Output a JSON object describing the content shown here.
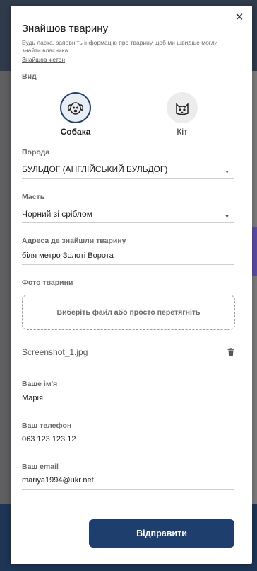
{
  "modal": {
    "title": "Знайшов тварину",
    "subtitle": "Будь ласка, заповніть інформацію про тварину щоб ми швидше могли знайти власника",
    "tag_link": "Знайшов жетон"
  },
  "species": {
    "label": "Вид",
    "options": [
      {
        "name": "Собака",
        "icon": "dog-icon",
        "selected": true
      },
      {
        "name": "Кіт",
        "icon": "cat-icon",
        "selected": false
      }
    ]
  },
  "breed": {
    "label": "Порода",
    "value": "БУЛЬДОГ (АНГЛІЙСЬКИЙ БУЛЬДОГ)"
  },
  "color": {
    "label": "Масть",
    "value": "Чорний зі сріблом"
  },
  "address": {
    "label": "Адреса де знайшли тварину",
    "value": "біля метро Золоті Ворота"
  },
  "photo": {
    "label": "Фото тварини",
    "dropzone": "Виберіть файл або просто перетягніть",
    "file_name": "Screenshot_1.jpg"
  },
  "name": {
    "label": "Ваше ім'я",
    "value": "Марія"
  },
  "phone": {
    "label": "Ваш телефон",
    "value": "063 123 123 12"
  },
  "email": {
    "label": "Ваш email",
    "value": "mariya1994@ukr.net"
  },
  "submit_label": "Відправити",
  "colors": {
    "primary": "#1e3f6e",
    "label_gray": "#6b6b6b"
  }
}
